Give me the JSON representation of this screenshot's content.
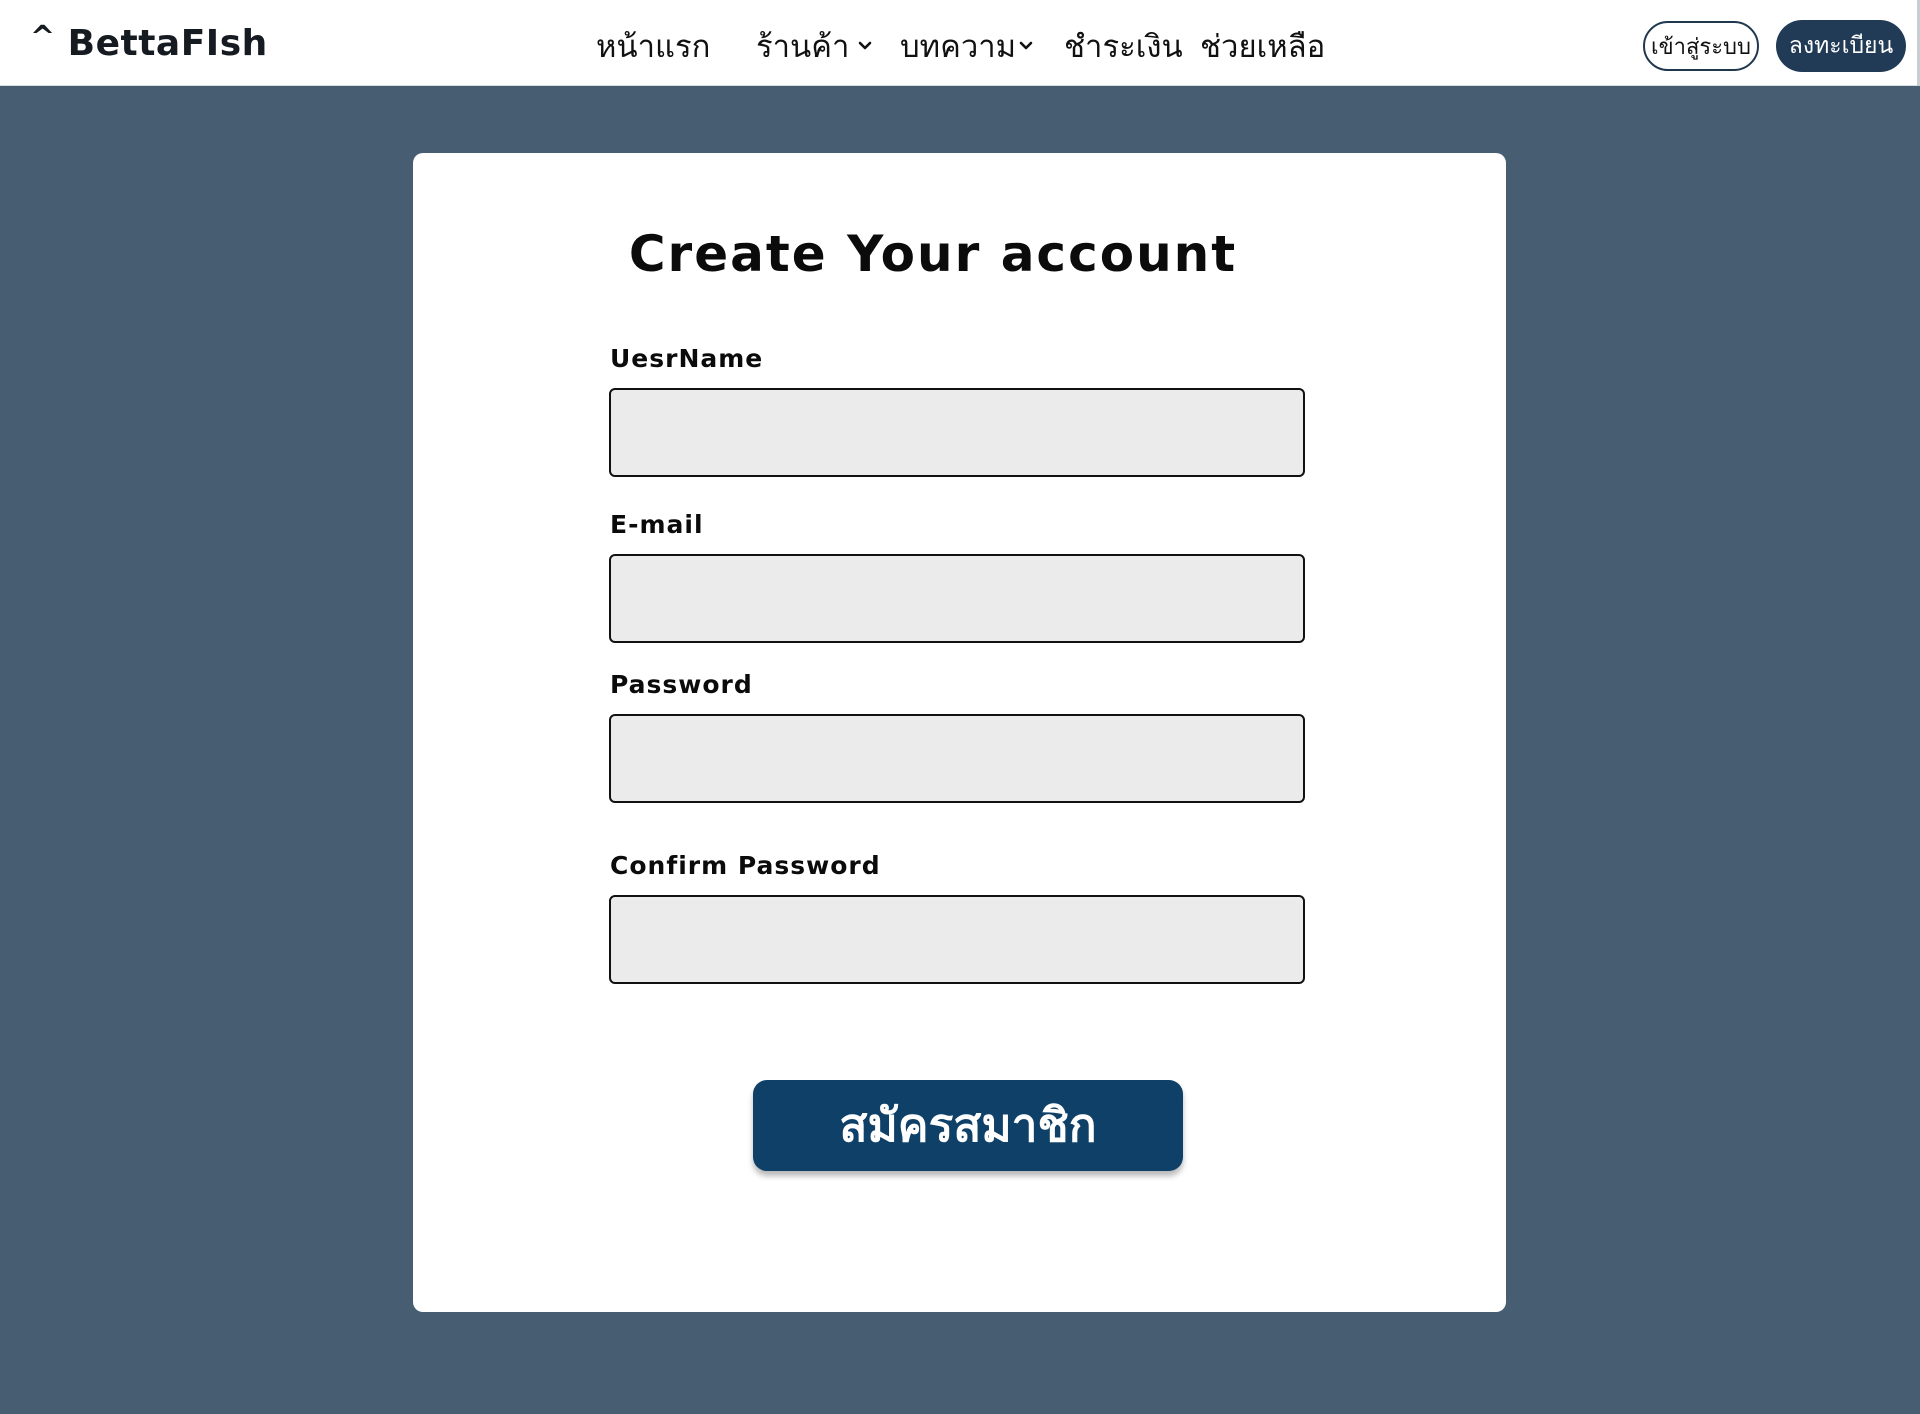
{
  "brand": {
    "caret": "^",
    "name": "BettaFIsh"
  },
  "nav": {
    "items": [
      {
        "label": "หน้าแรก"
      },
      {
        "label": "ร้านค้า"
      },
      {
        "label": "บทความ"
      },
      {
        "label": "ชำระเงิน"
      },
      {
        "label": "ช่วยเหลือ"
      }
    ],
    "login_label": "เข้าสู่ระบบ",
    "register_label": "ลงทะเบียน"
  },
  "form": {
    "title": "Create Your account",
    "fields": [
      {
        "label": "UesrName",
        "value": ""
      },
      {
        "label": "E-mail",
        "value": ""
      },
      {
        "label": "Password",
        "value": ""
      },
      {
        "label": "Confirm Password",
        "value": ""
      }
    ],
    "submit_label": "สมัครสมาชิก"
  },
  "colors": {
    "background": "#475d71",
    "primary_button": "#0f4068",
    "nav_register": "#213a55",
    "input_fill": "#ebebeb"
  }
}
